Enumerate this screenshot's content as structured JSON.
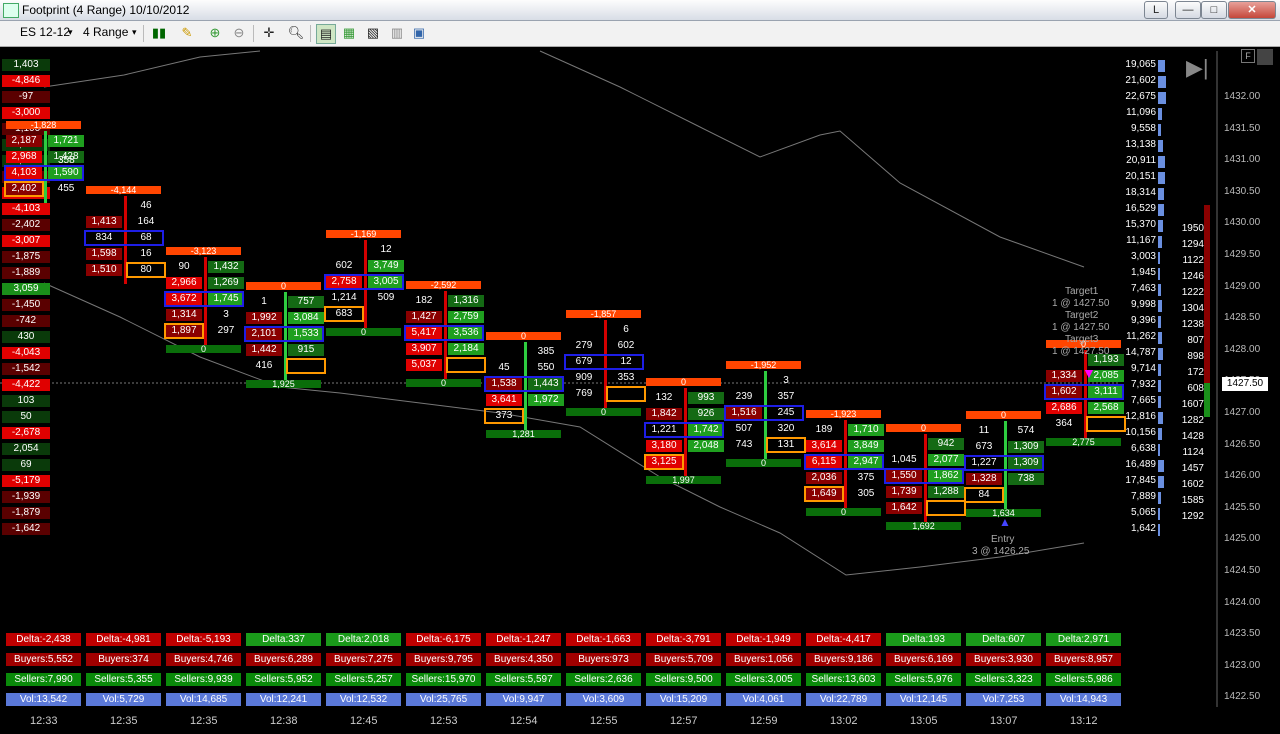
{
  "window": {
    "title": "Footprint (4 Range)  10/10/2012",
    "btn_l": "L",
    "btn_min": "—",
    "btn_max": "□",
    "btn_close": "✕"
  },
  "toolbar": {
    "instrument": "ES 12-12",
    "period": "4 Range"
  },
  "price_marker": "1427.50",
  "icons": [
    "bars-icon",
    "pencil-icon",
    "zoom-in-icon",
    "zoom-out-icon",
    "crosshair-icon",
    "search-icon",
    "data-box-icon",
    "properties-icon",
    "chart-trader-icon",
    "strategy-icon",
    "panel-icon"
  ],
  "left_col": [
    "1,403",
    "-4,846",
    "-97",
    "-3,000",
    "-1,100",
    "1,218",
    "1,641",
    "-2,187",
    "-2,968",
    "-4,103",
    "-2,402",
    "-3,007",
    "-1,875",
    "-1,889",
    "3,059",
    "-1,450",
    "-742",
    "430",
    "-4,043",
    "-1,542",
    "-4,422",
    "103",
    "50",
    "-2,678",
    "2,054",
    "69",
    "-5,179",
    "-1,939",
    "-1,879",
    "-1,642"
  ],
  "right_vol": [
    "19,065",
    "21,602",
    "22,675",
    "11,096",
    "9,558",
    "13,138",
    "20,911",
    "20,151",
    "18,314",
    "16,529",
    "15,370",
    "11,167",
    "3,003",
    "1,945",
    "7,463",
    "9,998",
    "9,396",
    "11,262",
    "14,787",
    "9,714",
    "7,932",
    "7,665",
    "12,816",
    "10,156",
    "6,638",
    "16,489",
    "17,845",
    "7,889",
    "5,065",
    "1,642"
  ],
  "dom": [
    "1950",
    "1294",
    "1122",
    "1246",
    "1222",
    "1304",
    "1238",
    "807",
    "898",
    "172",
    "608",
    "1607",
    "1282",
    "1428",
    "1124",
    "1457",
    "1602",
    "1585",
    "1292"
  ],
  "axis_prices": [
    "1432.00",
    "1431.50",
    "1431.00",
    "1430.50",
    "1430.00",
    "1429.50",
    "1429.00",
    "1428.50",
    "1428.00",
    "1427.50",
    "1427.00",
    "1426.50",
    "1426.00",
    "1425.50",
    "1425.00",
    "1424.50",
    "1424.00",
    "1423.50",
    "1423.00",
    "1422.50"
  ],
  "times": [
    "12:33",
    "12:35",
    "12:35",
    "12:38",
    "12:45",
    "12:53",
    "12:54",
    "12:55",
    "12:57",
    "12:59",
    "13:02",
    "13:05",
    "13:07",
    "13:12"
  ],
  "bar_deltas": [
    "-1,828",
    "-4,144",
    "-3,123",
    "0",
    "-1,169",
    "-2,592",
    "0",
    "-1,857",
    "0",
    "-1,952",
    "-1,923",
    "0",
    "0",
    "0"
  ],
  "bar_vols": [
    "0",
    "1,925",
    "0",
    "0",
    "1,281",
    "0",
    "1,997",
    "0",
    "0",
    "1,692",
    "1,634",
    "2,775"
  ],
  "summary": {
    "delta": [
      "Delta:-2,438",
      "Delta:-4,981",
      "Delta:-5,193",
      "Delta:337",
      "Delta:2,018",
      "Delta:-6,175",
      "Delta:-1,247",
      "Delta:-1,663",
      "Delta:-3,791",
      "Delta:-1,949",
      "Delta:-4,417",
      "Delta:193",
      "Delta:607",
      "Delta:2,971"
    ],
    "buyers": [
      "Buyers:5,552",
      "Buyers:374",
      "Buyers:4,746",
      "Buyers:6,289",
      "Buyers:7,275",
      "Buyers:9,795",
      "Buyers:4,350",
      "Buyers:973",
      "Buyers:5,709",
      "Buyers:1,056",
      "Buyers:9,186",
      "Buyers:6,169",
      "Buyers:3,930",
      "Buyers:8,957"
    ],
    "sellers": [
      "Sellers:7,990",
      "Sellers:5,355",
      "Sellers:9,939",
      "Sellers:5,952",
      "Sellers:5,257",
      "Sellers:15,970",
      "Sellers:5,597",
      "Sellers:2,636",
      "Sellers:9,500",
      "Sellers:3,005",
      "Sellers:13,603",
      "Sellers:5,976",
      "Sellers:3,323",
      "Sellers:5,986"
    ],
    "vol": [
      "Vol:13,542",
      "Vol:5,729",
      "Vol:14,685",
      "Vol:12,241",
      "Vol:12,532",
      "Vol:25,765",
      "Vol:9,947",
      "Vol:3,609",
      "Vol:15,209",
      "Vol:4,061",
      "Vol:22,789",
      "Vol:12,145",
      "Vol:7,253",
      "Vol:14,943"
    ]
  },
  "targets": {
    "t1": "Target1",
    "t1v": "1 @ 1427.50",
    "t2": "Target2",
    "t2v": "1 @ 1427.50",
    "t3": "Target3",
    "t3v": "1 @ 1427.50",
    "entry": "Entry",
    "entryv": "3 @ 1426.25"
  },
  "footprints": [
    {
      "b": "1",
      "r": [
        [
          "2,187",
          "1,721"
        ],
        [
          "2,968",
          "1,428"
        ],
        [
          "4,103",
          "1,590"
        ],
        [
          "2,402",
          "455"
        ]
      ],
      "extra": "358"
    },
    {
      "b": "2",
      "r": [
        [
          "",
          "46"
        ],
        [
          "1,413",
          "164"
        ],
        [
          "834",
          "68"
        ],
        [
          "1,598",
          "16"
        ],
        [
          "1,510",
          "80"
        ]
      ]
    },
    {
      "b": "3",
      "r": [
        [
          "90",
          "1,432"
        ],
        [
          "2,966",
          "1,269"
        ],
        [
          "3,672",
          "1,745"
        ],
        [
          "1,314",
          "3"
        ],
        [
          "1,897",
          "297"
        ]
      ]
    },
    {
      "b": "4",
      "r": [
        [
          "1",
          "757"
        ],
        [
          "1,992",
          "3,084"
        ],
        [
          "2,101",
          "1,533"
        ],
        [
          "1,442",
          "915"
        ],
        [
          "416",
          ""
        ]
      ]
    },
    {
      "b": "5",
      "r": [
        [
          "",
          "12"
        ],
        [
          "602",
          "3,749"
        ],
        [
          "2,758",
          "3,005"
        ],
        [
          "1,214",
          "509"
        ],
        [
          "683",
          ""
        ]
      ]
    },
    {
      "b": "6",
      "r": [
        [
          "182",
          "1,316"
        ],
        [
          "1,427",
          "2,759"
        ],
        [
          "5,417",
          "3,536"
        ],
        [
          "3,907",
          "2,184"
        ],
        [
          "5,037",
          ""
        ]
      ]
    },
    {
      "b": "7",
      "r": [
        [
          "",
          "385"
        ],
        [
          "45",
          "550"
        ],
        [
          "1,538",
          "1,443"
        ],
        [
          "3,641",
          "1,972"
        ],
        [
          "373",
          ""
        ]
      ]
    },
    {
      "b": "8",
      "r": [
        [
          "",
          "6"
        ],
        [
          "279",
          "602"
        ],
        [
          "679",
          "12"
        ],
        [
          "909",
          "353"
        ],
        [
          "769",
          ""
        ]
      ]
    },
    {
      "b": "9",
      "r": [
        [
          "132",
          "993"
        ],
        [
          "1,842",
          "926"
        ],
        [
          "1,221",
          "1,742"
        ],
        [
          "3,180",
          "2,048"
        ],
        [
          "3,125",
          ""
        ]
      ]
    },
    {
      "b": "10",
      "r": [
        [
          "",
          "3"
        ],
        [
          "239",
          "357"
        ],
        [
          "1,516",
          "245"
        ],
        [
          "507",
          "320"
        ],
        [
          "743",
          "131"
        ]
      ]
    },
    {
      "b": "11",
      "r": [
        [
          "189",
          "1,710"
        ],
        [
          "3,614",
          "3,849"
        ],
        [
          "6,115",
          "2,947"
        ],
        [
          "2,036",
          "375"
        ],
        [
          "1,649",
          "305"
        ]
      ]
    },
    {
      "b": "12",
      "r": [
        [
          "",
          "942"
        ],
        [
          "1,045",
          "2,077"
        ],
        [
          "1,550",
          "1,862"
        ],
        [
          "1,739",
          "1,288"
        ],
        [
          "1,642",
          ""
        ]
      ]
    },
    {
      "b": "13",
      "r": [
        [
          "11",
          "574"
        ],
        [
          "673",
          "1,309"
        ],
        [
          "1,227",
          "1,309"
        ],
        [
          "1,328",
          "738"
        ],
        [
          "84",
          ""
        ]
      ]
    },
    {
      "b": "14",
      "r": [
        [
          "",
          "1,193"
        ],
        [
          "1,334",
          "2,085"
        ],
        [
          "1,602",
          "3,111"
        ],
        [
          "2,686",
          "2,568"
        ],
        [
          "364",
          ""
        ]
      ]
    }
  ],
  "colors": {
    "sell": "#c00000",
    "buy": "#1f8f1f",
    "delta_bar": "#ff4500",
    "vol_bar": "#0a6e0a",
    "box_blue": "#1e1ee6",
    "box_orange": "#ff9900",
    "axis": "#bbbbbb",
    "volblue": "#6a8fe0"
  }
}
